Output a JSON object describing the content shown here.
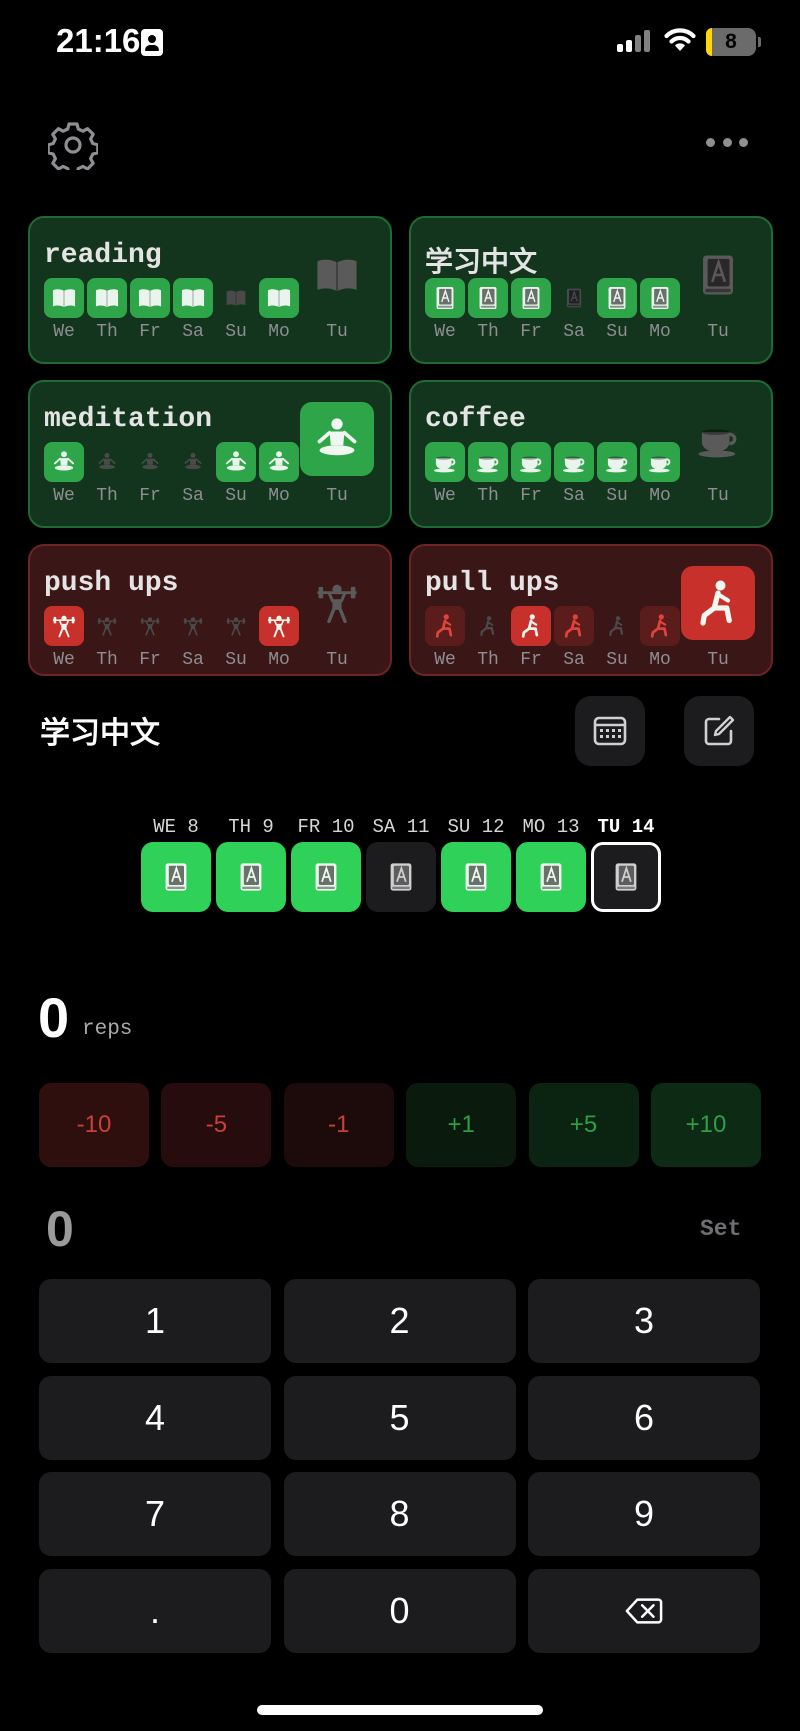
{
  "status_bar": {
    "time": "21:16",
    "battery": "8"
  },
  "top_bar": {
    "settings_icon": "gear-icon",
    "more_icon": "ellipsis-icon"
  },
  "day_labels": [
    "We",
    "Th",
    "Fr",
    "Sa",
    "Su",
    "Mo"
  ],
  "today_label": "Tu",
  "colors": {
    "done_green": "#2fa54a",
    "done_red": "#c8302c",
    "card_green_bg": "#13341d",
    "card_red_bg": "#3a1616",
    "detail_done": "#30d158"
  },
  "habits": [
    {
      "title": "reading",
      "icon": "book-icon",
      "theme": "green",
      "done": [
        true,
        true,
        true,
        true,
        false,
        true
      ],
      "today_done": false
    },
    {
      "title": "学习中文",
      "icon": "dictionary-icon",
      "theme": "green",
      "done": [
        true,
        true,
        true,
        false,
        true,
        true
      ],
      "today_done": false
    },
    {
      "title": "meditation",
      "icon": "meditation-icon",
      "theme": "green",
      "done": [
        true,
        false,
        false,
        false,
        true,
        true
      ],
      "today_done": true
    },
    {
      "title": "coffee",
      "icon": "coffee-cup-icon",
      "theme": "green",
      "done": [
        true,
        true,
        true,
        true,
        true,
        true
      ],
      "today_done": false
    },
    {
      "title": "push ups",
      "icon": "weightlifting-icon",
      "theme": "red",
      "done": [
        true,
        false,
        false,
        false,
        false,
        true
      ],
      "today_done": false
    },
    {
      "title": "pull ups",
      "icon": "lunge-icon",
      "theme": "red",
      "done": [
        "partial",
        false,
        true,
        "partial",
        false,
        "partial"
      ],
      "today_done": true
    }
  ],
  "detail": {
    "title": "学习中文",
    "calendar_icon": "calendar-icon",
    "edit_icon": "edit-icon",
    "week": [
      {
        "label": "WE 8",
        "done": true
      },
      {
        "label": "TH 9",
        "done": true
      },
      {
        "label": "FR 10",
        "done": true
      },
      {
        "label": "SA 11",
        "done": false
      },
      {
        "label": "SU 12",
        "done": true
      },
      {
        "label": "MO 13",
        "done": true
      },
      {
        "label": "TU 14",
        "done": false,
        "current": true
      }
    ],
    "reps_value": "0",
    "reps_unit": "reps",
    "increments": [
      "-10",
      "-5",
      "-1",
      "+1",
      "+5",
      "+10"
    ],
    "entry_value": "0",
    "set_label": "Set"
  },
  "keypad": [
    "1",
    "2",
    "3",
    "4",
    "5",
    "6",
    "7",
    "8",
    "9",
    ".",
    "0",
    "backspace-icon"
  ]
}
